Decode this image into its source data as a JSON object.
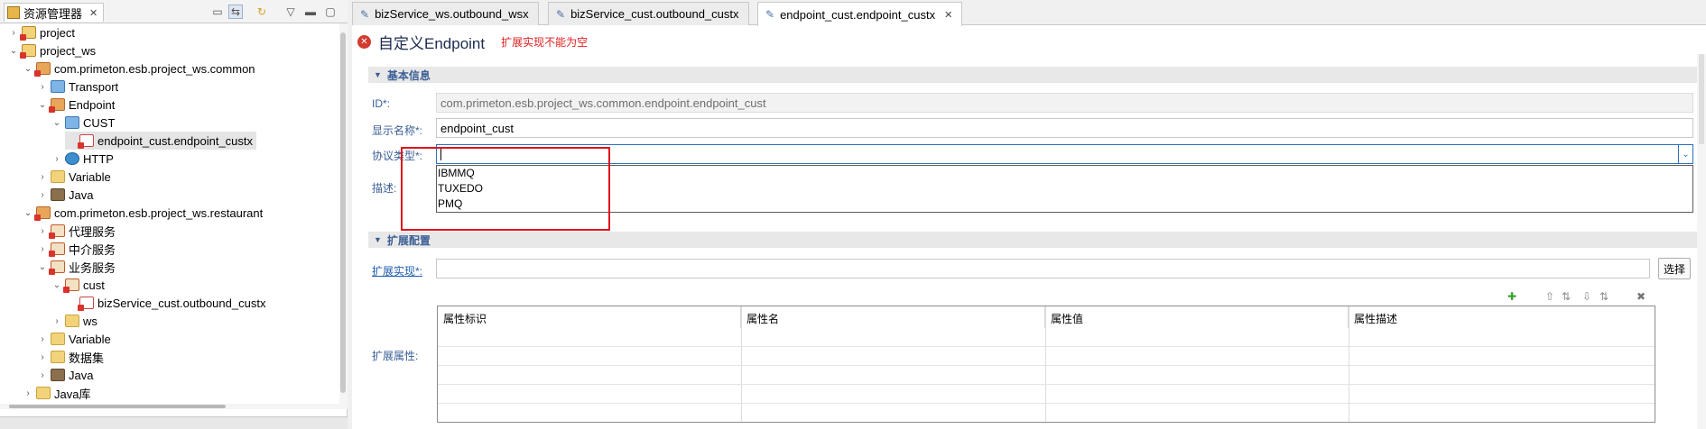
{
  "left_panel": {
    "tab_label": "资源管理器",
    "toolbar_icons": [
      "collapse-all-icon",
      "link-editor-icon",
      "refresh-icon",
      "view-menu-icon",
      "minimize-icon",
      "maximize-icon"
    ],
    "tree": [
      {
        "label": "project",
        "expander": "›",
        "indent": 0,
        "icon": "project"
      },
      {
        "label": "project_ws",
        "expander": "⌄",
        "indent": 0,
        "icon": "project"
      },
      {
        "label": "com.primeton.esb.project_ws.common",
        "expander": "⌄",
        "indent": 1,
        "icon": "pkg"
      },
      {
        "label": "Transport",
        "expander": "›",
        "indent": 2,
        "icon": "blue"
      },
      {
        "label": "Endpoint",
        "expander": "⌄",
        "indent": 2,
        "icon": "pkg"
      },
      {
        "label": "CUST",
        "expander": "⌄",
        "indent": 3,
        "icon": "blue"
      },
      {
        "label": "endpoint_cust.endpoint_custx",
        "expander": "",
        "indent": 4,
        "icon": "file",
        "selected": true
      },
      {
        "label": "HTTP",
        "expander": "›",
        "indent": 3,
        "icon": "globe"
      },
      {
        "label": "Variable",
        "expander": "›",
        "indent": 2,
        "icon": "folder"
      },
      {
        "label": "Java",
        "expander": "›",
        "indent": 2,
        "icon": "java"
      },
      {
        "label": "com.primeton.esb.project_ws.restaurant",
        "expander": "⌄",
        "indent": 1,
        "icon": "pkg"
      },
      {
        "label": "代理服务",
        "expander": "›",
        "indent": 2,
        "icon": "red"
      },
      {
        "label": "中介服务",
        "expander": "›",
        "indent": 2,
        "icon": "red"
      },
      {
        "label": "业务服务",
        "expander": "⌄",
        "indent": 2,
        "icon": "red"
      },
      {
        "label": "cust",
        "expander": "⌄",
        "indent": 3,
        "icon": "red"
      },
      {
        "label": "bizService_cust.outbound_custx",
        "expander": "",
        "indent": 4,
        "icon": "file"
      },
      {
        "label": "ws",
        "expander": "›",
        "indent": 3,
        "icon": "folder"
      },
      {
        "label": "Variable",
        "expander": "›",
        "indent": 2,
        "icon": "folder"
      },
      {
        "label": "数据集",
        "expander": "›",
        "indent": 2,
        "icon": "folder"
      },
      {
        "label": "Java",
        "expander": "›",
        "indent": 2,
        "icon": "java"
      },
      {
        "label": "Java库",
        "expander": "›",
        "indent": 1,
        "icon": "folder"
      }
    ]
  },
  "editor": {
    "tabs": [
      {
        "label": "bizService_ws.outbound_wsx",
        "active": false
      },
      {
        "label": "bizService_cust.outbound_custx",
        "active": false
      },
      {
        "label": "endpoint_cust.endpoint_custx",
        "active": true
      }
    ],
    "title": "自定义Endpoint",
    "error_message": "扩展实现不能为空",
    "basic_section": "基本信息",
    "id_label": "ID*:",
    "id_value": "com.primeton.esb.project_ws.common.endpoint.endpoint_cust",
    "display_name_label": "显示名称*:",
    "display_name_value": "endpoint_cust",
    "protocol_label": "协议类型*:",
    "protocol_value": "",
    "protocol_options": [
      "IBMMQ",
      "TUXEDO",
      "PMQ"
    ],
    "description_label": "描述:",
    "ext_section": "扩展配置",
    "ext_impl_label": "扩展实现*:",
    "ext_impl_value": "",
    "select_button": "选择",
    "ext_props_label": "扩展属性:",
    "table_columns": [
      "属性标识",
      "属性名",
      "属性值",
      "属性描述"
    ],
    "table_rows": 5,
    "table_toolbar_icons": [
      "add-icon",
      "move-top-icon",
      "move-up-icon",
      "move-down-icon",
      "move-bottom-icon",
      "delete-icon"
    ]
  },
  "colors": {
    "error": "#e02020",
    "highlight_box": "#e0121a",
    "section_text": "#3a5e95",
    "link": "#1e5eb0"
  }
}
